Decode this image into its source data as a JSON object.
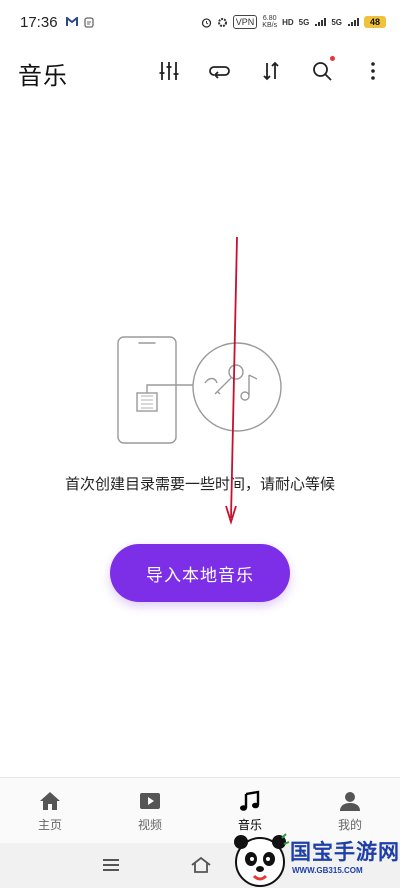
{
  "status_bar": {
    "time": "17:36",
    "left_icons": [
      "gmail-icon",
      "notification-icon"
    ],
    "vpn": "VPN",
    "net_speed_value": "6.80",
    "net_speed_unit": "KB/s",
    "hd1": "HD",
    "signal1": "5G",
    "signal2": "5G",
    "battery": "48"
  },
  "toolbar": {
    "title": "音乐",
    "icons": [
      "equalizer-icon",
      "repeat-icon",
      "sort-icon",
      "search-icon",
      "more-vertical-icon"
    ]
  },
  "empty_state": {
    "message": "首次创建目录需要一些时间，请耐心等候",
    "import_button": "导入本地音乐"
  },
  "bottom_nav": {
    "items": [
      {
        "label": "主页",
        "icon": "home-icon"
      },
      {
        "label": "视频",
        "icon": "video-icon"
      },
      {
        "label": "音乐",
        "icon": "music-note-icon"
      },
      {
        "label": "我的",
        "icon": "profile-icon"
      }
    ]
  },
  "watermark": {
    "brand": "国宝手游网",
    "url": "WWW.GB315.COM"
  },
  "colors": {
    "accent": "#7d2fe8",
    "annotation": "#c8102e"
  }
}
